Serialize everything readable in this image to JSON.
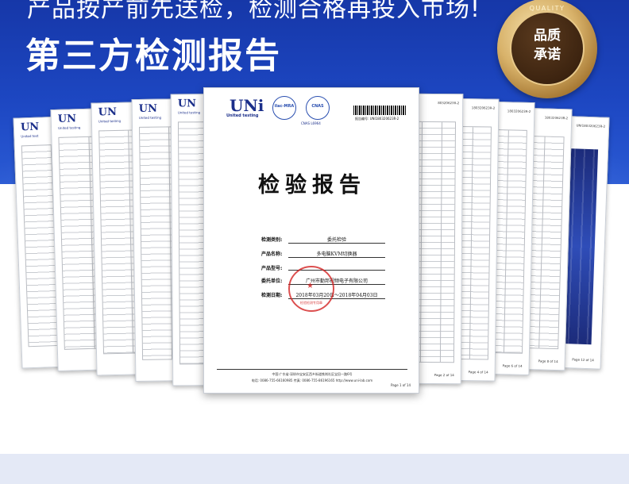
{
  "hero": {
    "headline": "产品按产前先送检，检测合格再投入市场!",
    "title": "第三方检测报告"
  },
  "badge": {
    "ring_text": "QUALITY",
    "line1": "品质",
    "line2": "承诺"
  },
  "left_docs": [
    {
      "logo": "UN",
      "logo_sub": "United test",
      "page": ""
    },
    {
      "logo": "UN",
      "logo_sub": "United testing",
      "page": ""
    },
    {
      "logo": "UN",
      "logo_sub": "United testing",
      "page": ""
    },
    {
      "logo": "UN",
      "logo_sub": "United testing",
      "page": ""
    },
    {
      "logo": "UN",
      "logo_sub": "United testing",
      "page": ""
    }
  ],
  "right_docs": [
    {
      "report_no": "80320623R-2",
      "page": "Page 2 of 14"
    },
    {
      "report_no": "180320623R-2",
      "page": "Page 4 of 14"
    },
    {
      "report_no": "180320623R-2",
      "page": "Page 6 of 14"
    },
    {
      "report_no": "180320623R-2",
      "page": "Page 8 of 14"
    },
    {
      "report_no": "UNI180320623R-2",
      "page": "Page 12 of 14"
    }
  ],
  "front": {
    "logo": "UNi",
    "logo_sub": "United testing",
    "ilac": "ilac-MRA",
    "cnas": "CNAS",
    "cnas_sub": "CNAS L6964",
    "report_no": "报告编号: UNI180320623R-2",
    "title": "检验报告",
    "fields": [
      {
        "label": "检测类别:",
        "value": "委托检验"
      },
      {
        "label": "产品名称:",
        "value": "多电脑KVM切换器"
      },
      {
        "label": "产品型号:",
        "value": ""
      },
      {
        "label": "委托单位:",
        "value": "广州市勤邦视频电子有限公司"
      },
      {
        "label": "检测日期:",
        "value": "2018年03月20日～2018年04月03日"
      }
    ],
    "seal_text": "检验检测专用章",
    "address": "中国·广东省·深圳市宝安区西乡街道铁岗社区宝田一路6号",
    "tel": "电话: 0086-755-66160985    传真: 0086-755-86196165    http://www.uni-lab.com",
    "page": "Page 1 of 14"
  }
}
